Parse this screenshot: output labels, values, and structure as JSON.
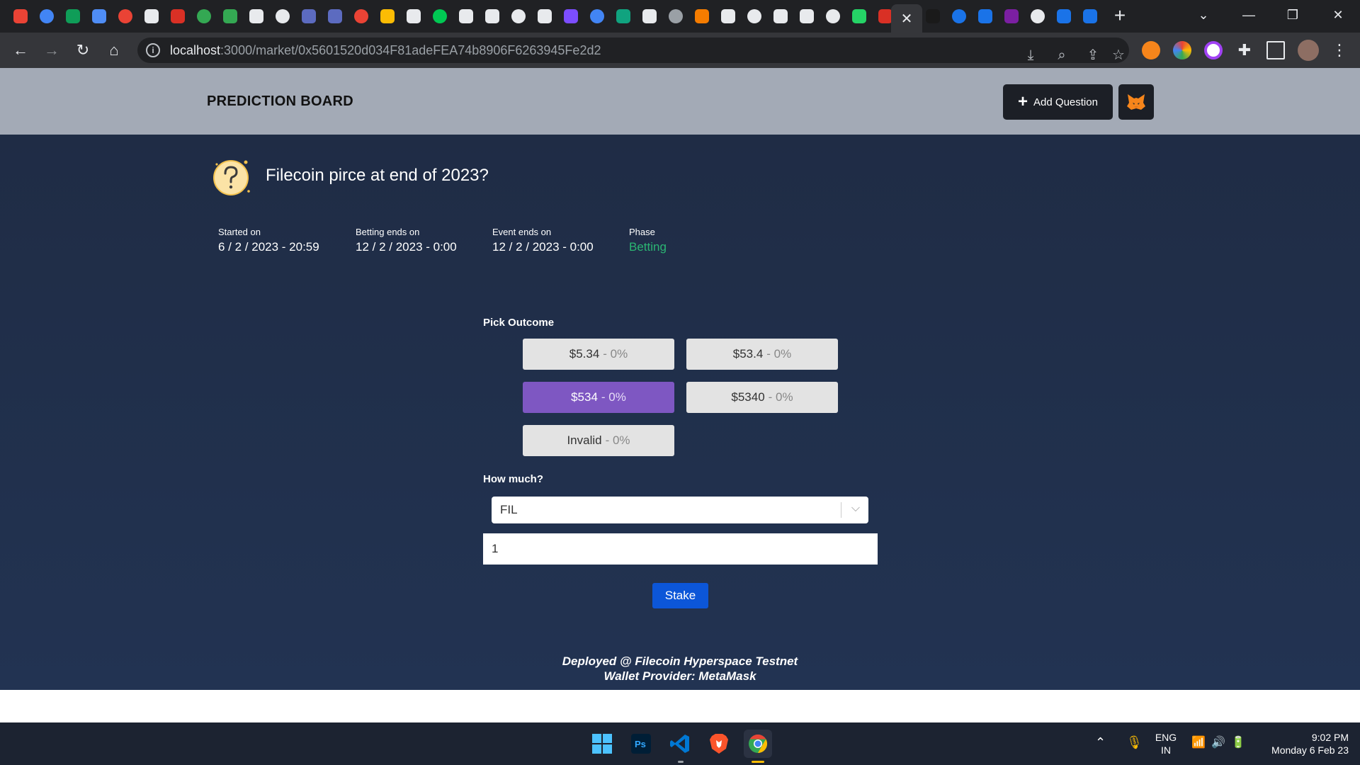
{
  "browser": {
    "url_host": "localhost",
    "url_path": ":3000/market/0x5601520d034F81adeFEA74b8906F6263945Fe2d2",
    "tab_colors": [
      "#ea4335",
      "#4285f4",
      "#0f9d58",
      "#4f8df5",
      "#ea4335",
      "#e8eaed",
      "#d93025",
      "#34a853",
      "#34a853",
      "#e8eaed",
      "#e8eaed",
      "#5c6bc0",
      "#5c6bc0",
      "#ea4335",
      "#fbbc04",
      "#e8eaed",
      "#00c853",
      "#e8eaed",
      "#e8eaed",
      "#e8eaed",
      "#e8eaed",
      "#7c4dff",
      "#4285f4",
      "#10a37f",
      "#e8eaed",
      "#9aa0a6",
      "#f57c00",
      "#e8eaed",
      "#e8eaed",
      "#e8eaed",
      "#e8eaed",
      "#e8eaed",
      "#25d366",
      "#d93025"
    ],
    "tab_colors_right": [
      "#1a1a1a",
      "#1a73e8",
      "#1a73e8",
      "#7b1fa2",
      "#e8eaed",
      "#1a73e8",
      "#1a73e8"
    ]
  },
  "app": {
    "brand": "PREDICTION BOARD",
    "add_question_label": "Add Question",
    "question_title": "Filecoin pirce at end of 2023?",
    "meta": [
      {
        "label": "Started on",
        "value": "6 / 2 / 2023 - 20:59"
      },
      {
        "label": "Betting ends on",
        "value": "12 / 2 / 2023 - 0:00"
      },
      {
        "label": "Event ends on",
        "value": "12 / 2 / 2023 - 0:00"
      },
      {
        "label": "Phase",
        "value": "Betting"
      }
    ],
    "pick_outcome_label": "Pick Outcome",
    "outcomes": [
      {
        "label": "$5.34",
        "pct": "- 0%"
      },
      {
        "label": "$53.4",
        "pct": "- 0%"
      },
      {
        "label": "$534",
        "pct": "- 0%"
      },
      {
        "label": "$5340",
        "pct": "- 0%"
      },
      {
        "label": "Invalid",
        "pct": "- 0%"
      }
    ],
    "how_much_label": "How much?",
    "token_selected": "FIL",
    "amount_value": "1",
    "stake_label": "Stake",
    "footer_line1": "Deployed @ Filecoin Hyperspace Testnet",
    "footer_line2": "Wallet Provider: MetaMask"
  },
  "taskbar": {
    "lang_1": "ENG",
    "lang_2": "IN",
    "time": "9:02 PM",
    "date": "Monday 6 Feb 23"
  }
}
